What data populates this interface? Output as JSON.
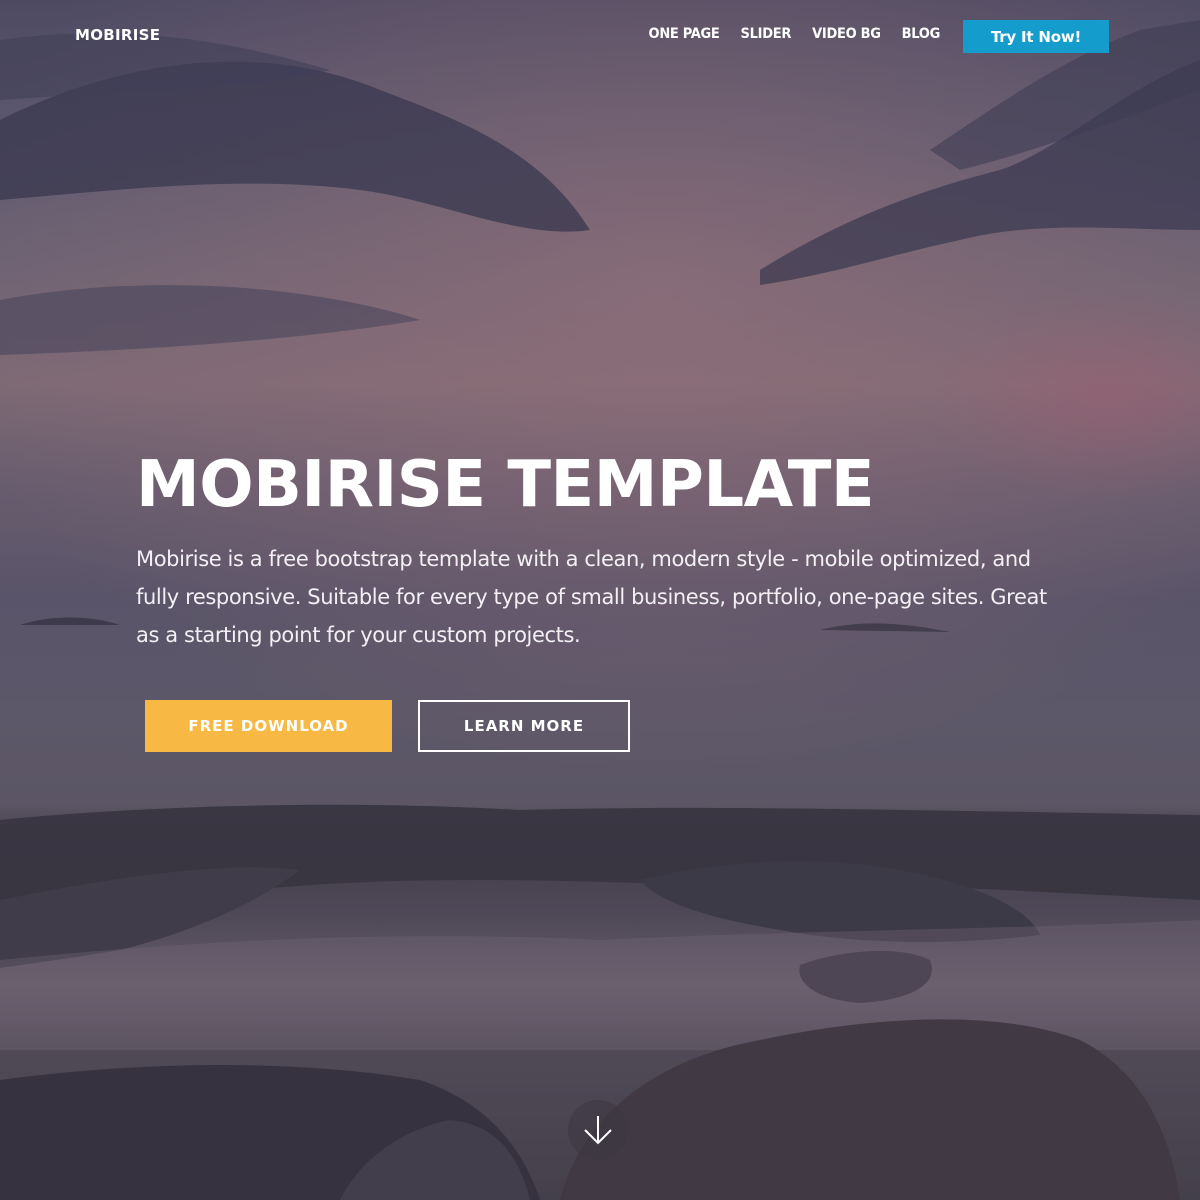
{
  "navbar": {
    "brand": "MOBIRISE",
    "links": [
      "ONE PAGE",
      "SLIDER",
      "VIDEO BG",
      "BLOG"
    ],
    "cta_label": "Try It Now!",
    "cta_color": "#149dcc"
  },
  "hero": {
    "title": "MOBIRISE TEMPLATE",
    "text": "Mobirise is a free bootstrap template with a clean, modern style - mobile optimized, and fully responsive. Suitable for every type of small business, portfolio, one-page sites. Great as a starting point for your custom projects.",
    "primary_button": "FREE DOWNLOAD",
    "primary_color": "#f7b944",
    "secondary_button": "LEARN MORE"
  },
  "scroll": {
    "icon": "arrow-down-icon"
  }
}
